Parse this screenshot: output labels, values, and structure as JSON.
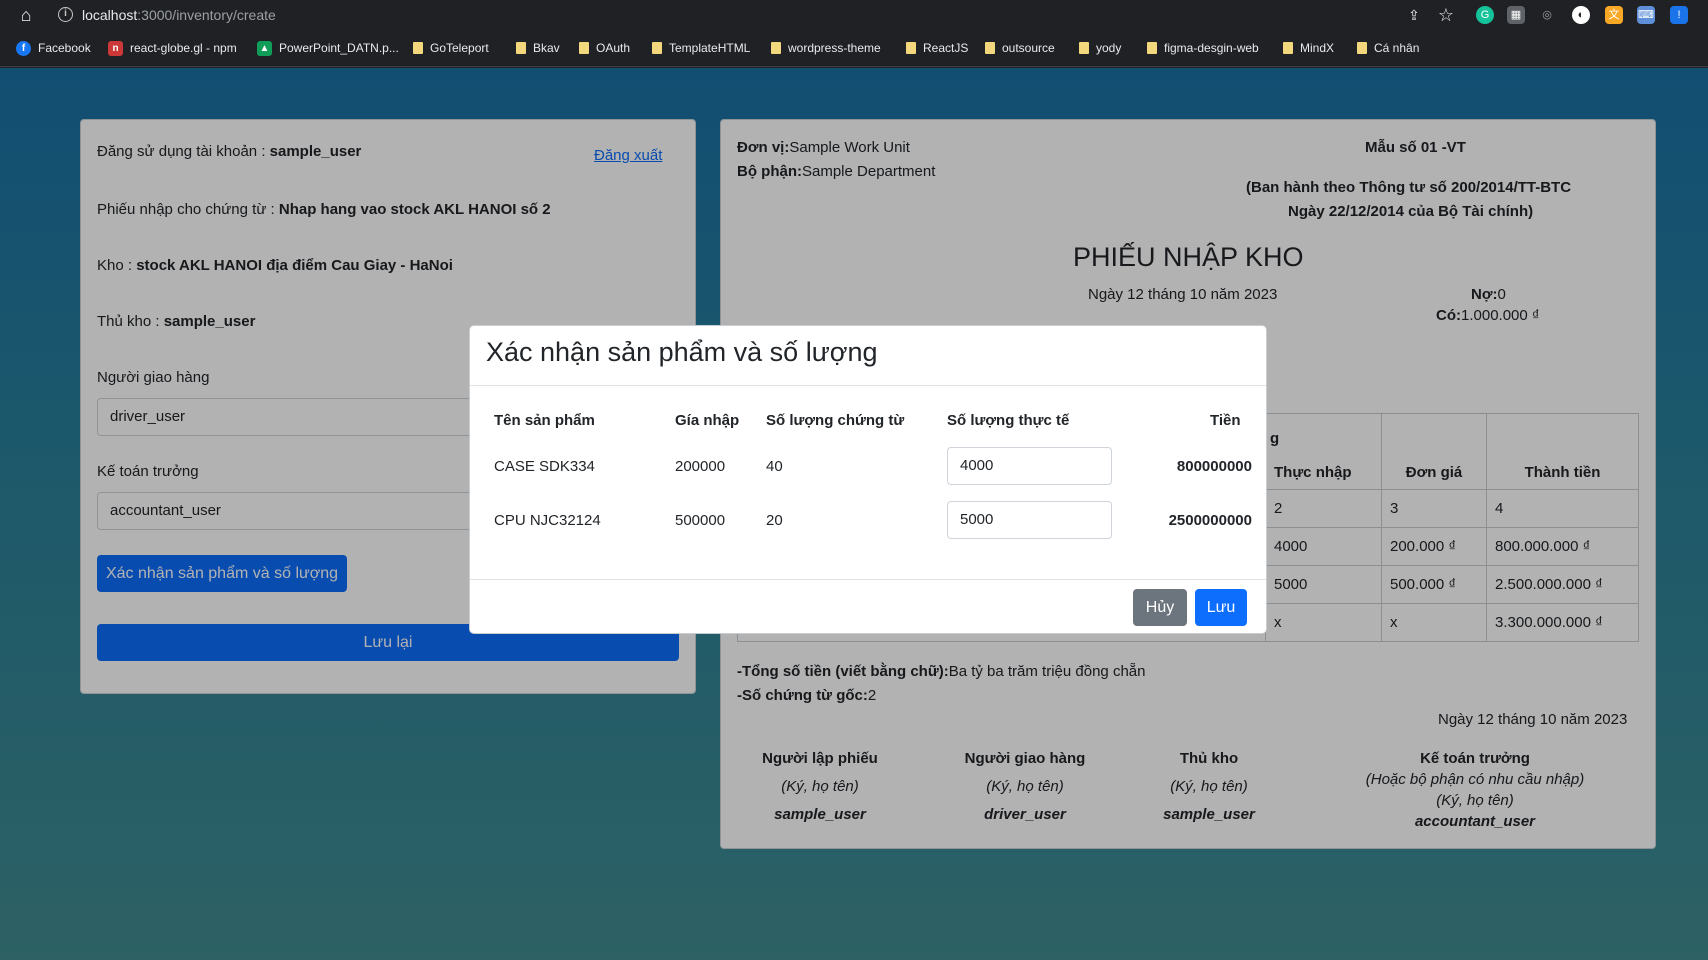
{
  "browser": {
    "url_host": "localhost",
    "url_path": ":3000/inventory/create",
    "bookmarks": [
      {
        "label": "Facebook",
        "icon": "facebook-icon"
      },
      {
        "label": "react-globe.gl - npm",
        "icon": "npm-icon"
      },
      {
        "label": "PowerPoint_DATN.p...",
        "icon": "drive-icon"
      },
      {
        "label": "GoTeleport",
        "icon": "folder-icon"
      },
      {
        "label": "Bkav",
        "icon": "folder-icon"
      },
      {
        "label": "OAuth",
        "icon": "folder-icon"
      },
      {
        "label": "TemplateHTML",
        "icon": "folder-icon"
      },
      {
        "label": "wordpress-theme",
        "icon": "folder-icon"
      },
      {
        "label": "ReactJS",
        "icon": "folder-icon"
      },
      {
        "label": "outsource",
        "icon": "folder-icon"
      },
      {
        "label": "yody",
        "icon": "folder-icon"
      },
      {
        "label": "figma-desgin-web",
        "icon": "folder-icon"
      },
      {
        "label": "MindX",
        "icon": "folder-icon"
      },
      {
        "label": "Cá nhân",
        "icon": "folder-icon"
      }
    ]
  },
  "form": {
    "account_label": "Đăng sử dụng tài khoản : ",
    "account_value": "sample_user",
    "logout": "Đăng xuất",
    "voucher_label": "Phiếu nhập cho chứng từ : ",
    "voucher_value": "Nhap hang vao stock AKL HANOI số 2",
    "warehouse_label": "Kho : ",
    "warehouse_value": "stock AKL HANOI địa điểm Cau Giay - HaNoi",
    "keeper_label": "Thủ kho : ",
    "keeper_value": "sample_user",
    "deliverer_label": "Người giao hàng",
    "deliverer_value": "driver_user",
    "accountant_label": "Kế toán trưởng",
    "accountant_value": "accountant_user",
    "confirm_button": "Xác nhận sản phẩm và số lượng",
    "save_button": "Lưu lại"
  },
  "doc": {
    "unit_label": "Đơn vị:",
    "unit_value": "Sample Work Unit",
    "dept_label": "Bộ phận:",
    "dept_value": "Sample Department",
    "form_no": "Mẫu số 01 -VT",
    "decree_line1": "(Ban hành theo Thông tư số 200/2014/TT-BTC",
    "decree_line2": "Ngày 22/12/2014 của Bộ Tài chính)",
    "title": "PHIẾU NHẬP KHO",
    "date": "Ngày 12 tháng 10 năm 2023",
    "debit_label": "Nợ:",
    "debit_value": "0",
    "credit_label": "Có:",
    "credit_value": "1.000.000 ₫",
    "table_partial_header": "g",
    "table_headers": [
      "Thực nhập",
      "Đơn giá",
      "Thành tiền"
    ],
    "table_rows": [
      [
        "2",
        "3",
        "4"
      ],
      [
        "4000",
        "200.000 ₫",
        "800.000.000 ₫"
      ],
      [
        "5000",
        "500.000 ₫",
        "2.500.000.000 ₫"
      ],
      [
        "x",
        "x",
        "3.300.000.000 ₫"
      ]
    ],
    "total_words_label": "-Tổng số tiền (viết bằng chữ):",
    "total_words_value": "Ba tỷ ba trăm triệu đồng chẵn",
    "orig_docs_label": "-Số chứng từ gốc:",
    "orig_docs_value": "2",
    "sign_date": "Ngày 12 tháng 10 năm 2023",
    "signers": [
      {
        "title": "Người lập phiếu",
        "note": "(Ký, họ tên)",
        "name": "sample_user"
      },
      {
        "title": "Người giao hàng",
        "note": "(Ký, họ tên)",
        "name": "driver_user"
      },
      {
        "title": "Thủ kho",
        "note": "(Ký, họ tên)",
        "name": "sample_user"
      }
    ],
    "chief": {
      "title": "Kế toán trưởng",
      "note1": "(Hoặc bộ phận có nhu cầu nhập)",
      "note2": "(Ký, họ tên)",
      "name": "accountant_user"
    }
  },
  "modal": {
    "title": "Xác nhận sản phẩm và số lượng",
    "headers": [
      "Tên sản phẩm",
      "Gía nhập",
      "Số lượng chứng từ",
      "Số lượng thực tế",
      "Tiền"
    ],
    "rows": [
      {
        "name": "CASE SDK334",
        "price": "200000",
        "doc_qty": "40",
        "actual_qty": "4000",
        "amount": "800000000"
      },
      {
        "name": "CPU NJC32124",
        "price": "500000",
        "doc_qty": "20",
        "actual_qty": "5000",
        "amount": "2500000000"
      }
    ],
    "cancel": "Hủy",
    "save": "Lưu"
  }
}
